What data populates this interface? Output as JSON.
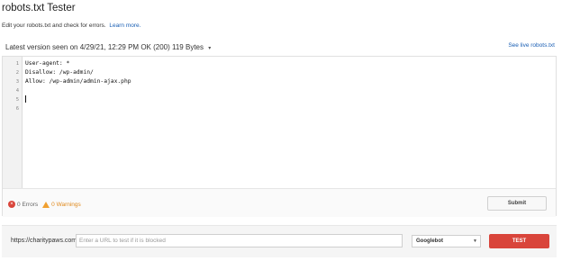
{
  "header": {
    "title": "robots.txt Tester",
    "subtitle": "Edit your robots.txt and check for errors.",
    "learn_more": "Learn more."
  },
  "version": {
    "text": "Latest version seen on 4/29/21, 12:29 PM OK (200) 119 Bytes",
    "caret": "▾",
    "see_live": "See live robots.txt"
  },
  "editor": {
    "line_numbers": [
      "1",
      "2",
      "3",
      "4",
      "5",
      "6"
    ],
    "lines": [
      "User-agent: *",
      "Disallow: /wp-admin/",
      "Allow: /wp-admin/admin-ajax.php",
      "",
      "",
      ""
    ]
  },
  "status": {
    "errors_count": "0",
    "errors_label": "Errors",
    "warnings_count": "0",
    "warnings_label": "Warnings",
    "submit_label": "Submit"
  },
  "tester": {
    "url_prefix": "https://charitypaws.com/",
    "url_placeholder": "Enter a URL to test if it is blocked",
    "url_value": "",
    "bot_selected": "Googlebot",
    "test_label": "TEST"
  },
  "colors": {
    "accent_red": "#d9453b",
    "link_blue": "#1a5fb4",
    "warning_orange": "#f0a030"
  },
  "icons": {
    "error": "error-circle-icon",
    "warning": "warning-triangle-icon",
    "dropdown": "chevron-down-icon"
  }
}
